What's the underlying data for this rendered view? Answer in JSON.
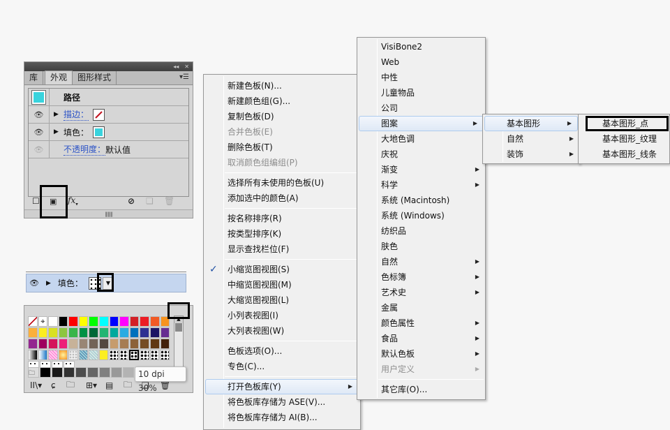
{
  "appearance_panel": {
    "tabs": [
      "库",
      "外观",
      "图形样式"
    ],
    "active_tab": "外观",
    "header_label": "路径",
    "rows": [
      {
        "label": "描边：",
        "swatch": "none-slash"
      },
      {
        "label": "填色：",
        "swatch": "#39d3dd"
      },
      {
        "label": "不透明度：",
        "value": "默认值"
      }
    ],
    "path_color": "#39d3dd",
    "bottom_icons": [
      "new-stroke-icon",
      "new-fill-icon",
      "fx-icon",
      "clear-icon",
      "duplicate-icon",
      "delete-icon"
    ],
    "fx_label": "fx"
  },
  "fill_strip": {
    "label": "填色："
  },
  "swatches_panel": {
    "tooltip": "10 dpi 30%",
    "rows": [
      [
        "none",
        "registration",
        "#ffffff",
        "#000000",
        "#ff0000",
        "#ffff00",
        "#00ff00",
        "#00ffff",
        "#0000ff",
        "#ff00ff",
        "#d32027",
        "#ec1c24",
        "#f15a24",
        "#f7931e"
      ],
      [
        "#fbb03b",
        "#fcee21",
        "#d9e021",
        "#8cc63f",
        "#39b54a",
        "#009245",
        "#006837",
        "#22b573",
        "#00a99d",
        "#29abe2",
        "#0071bc",
        "#2e3192",
        "#1b1464",
        "#662d91"
      ],
      [
        "#93278f",
        "#9e005d",
        "#d4145a",
        "#ed1e79",
        "#c7b299",
        "#998675",
        "#736357",
        "#534741",
        "#c69c6d",
        "#a67c52",
        "#8c6239",
        "#754c24",
        "#603813",
        "#42210b"
      ],
      [
        "gradient-bw",
        "gradient-blue",
        "pattern-pink",
        "gradient-orange",
        "pattern-dots",
        "pattern-blue",
        "pattern-green",
        "#fcee21",
        "pattern-dot",
        "pattern-dot",
        "pattern-dot-sel",
        "pattern-dot",
        "pattern-dot",
        "pattern-dot"
      ],
      [
        "pattern-sdot",
        "pattern-sdot",
        "pattern-sdot",
        "pattern-sdot"
      ]
    ],
    "grays": [
      "#000000",
      "#1a1a1a",
      "#333333",
      "#4d4d4d",
      "#666666",
      "#808080",
      "#999999",
      "#b3b3b3",
      "#cccccc",
      "#e6e6e6"
    ],
    "bottom_icons": [
      "library-icon",
      "kind-icon",
      "load-icon",
      "group-icon",
      "swatch-options-icon",
      "new-group-icon",
      "new-swatch-icon",
      "delete-icon"
    ]
  },
  "main_menu": {
    "items": [
      {
        "label": "新建色板(N)...",
        "enabled": true
      },
      {
        "label": "新建颜色组(G)...",
        "enabled": true
      },
      {
        "label": "复制色板(D)",
        "enabled": true
      },
      {
        "label": "合并色板(E)",
        "enabled": false
      },
      {
        "label": "删除色板(T)",
        "enabled": true
      },
      {
        "label": "取消颜色组编组(P)",
        "enabled": false
      },
      {
        "sep": true
      },
      {
        "label": "选择所有未使用的色板(U)",
        "enabled": true
      },
      {
        "label": "添加选中的颜色(A)",
        "enabled": true
      },
      {
        "sep": true
      },
      {
        "label": "按名称排序(R)",
        "enabled": true
      },
      {
        "label": "按类型排序(K)",
        "enabled": true
      },
      {
        "label": "显示查找栏位(F)",
        "enabled": true
      },
      {
        "sep": true
      },
      {
        "label": "小缩览图视图(S)",
        "enabled": true,
        "checked": true
      },
      {
        "label": "中缩览图视图(M)",
        "enabled": true
      },
      {
        "label": "大缩览图视图(L)",
        "enabled": true
      },
      {
        "label": "小列表视图(I)",
        "enabled": true
      },
      {
        "label": "大列表视图(W)",
        "enabled": true
      },
      {
        "sep": true
      },
      {
        "label": "色板选项(O)...",
        "enabled": true
      },
      {
        "label": "专色(C)...",
        "enabled": true
      },
      {
        "sep": true
      },
      {
        "label": "打开色板库(Y)",
        "enabled": true,
        "submenu": true,
        "hover": true
      },
      {
        "label": "将色板库存储为 ASE(V)...",
        "enabled": true
      },
      {
        "label": "将色板库存储为 AI(B)...",
        "enabled": true
      }
    ]
  },
  "library_menu": {
    "items": [
      {
        "label": "VisiBone2",
        "enabled": true
      },
      {
        "label": "Web",
        "enabled": true
      },
      {
        "label": "中性",
        "enabled": true
      },
      {
        "label": "儿童物品",
        "enabled": true
      },
      {
        "label": "公司",
        "enabled": true
      },
      {
        "label": "图案",
        "enabled": true,
        "submenu": true,
        "hover": true
      },
      {
        "label": "大地色调",
        "enabled": true
      },
      {
        "label": "庆祝",
        "enabled": true
      },
      {
        "label": "渐变",
        "enabled": true,
        "submenu": true
      },
      {
        "label": "科学",
        "enabled": true,
        "submenu": true
      },
      {
        "label": "系统 (Macintosh)",
        "enabled": true
      },
      {
        "label": "系统 (Windows)",
        "enabled": true
      },
      {
        "label": "纺织品",
        "enabled": true
      },
      {
        "label": "肤色",
        "enabled": true
      },
      {
        "label": "自然",
        "enabled": true,
        "submenu": true
      },
      {
        "label": "色标簿",
        "enabled": true,
        "submenu": true
      },
      {
        "label": "艺术史",
        "enabled": true,
        "submenu": true
      },
      {
        "label": "金属",
        "enabled": true
      },
      {
        "label": "颜色属性",
        "enabled": true,
        "submenu": true
      },
      {
        "label": "食品",
        "enabled": true,
        "submenu": true
      },
      {
        "label": "默认色板",
        "enabled": true,
        "submenu": true
      },
      {
        "label": "用户定义",
        "enabled": false,
        "submenu": true
      },
      {
        "sep": true
      },
      {
        "label": "其它库(O)...",
        "enabled": true
      }
    ]
  },
  "pattern_menu": {
    "items": [
      {
        "label": "基本图形",
        "submenu": true,
        "hover": true
      },
      {
        "label": "自然",
        "submenu": true
      },
      {
        "label": "装饰",
        "submenu": true
      }
    ]
  },
  "basic_shapes_menu": {
    "items": [
      {
        "label": "基本图形_点",
        "highlighted": true
      },
      {
        "label": "基本图形_纹理"
      },
      {
        "label": "基本图形_线条"
      }
    ]
  }
}
